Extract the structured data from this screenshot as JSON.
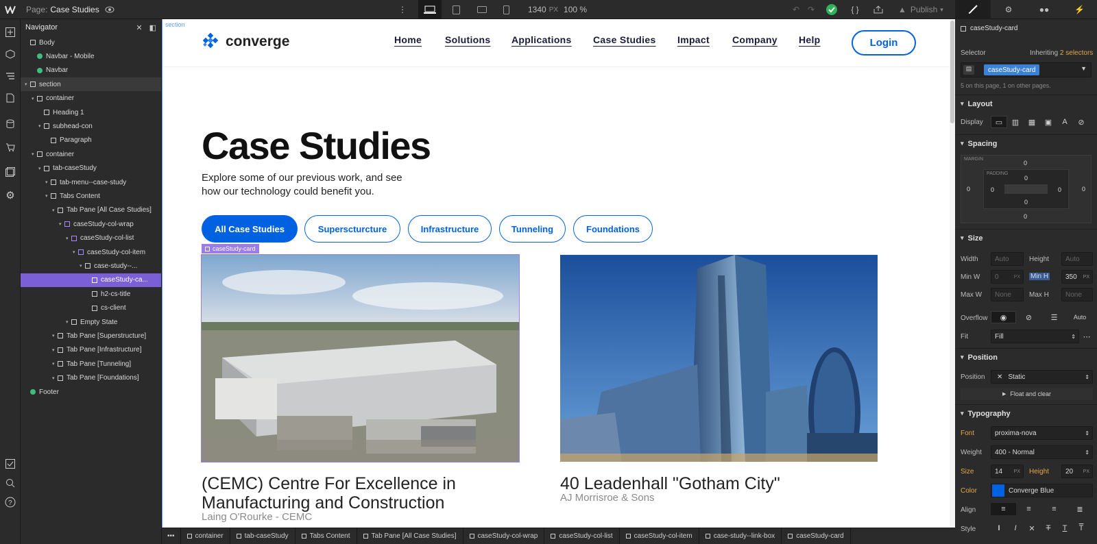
{
  "topbar": {
    "page_label": "Page:",
    "page_name": "Case Studies",
    "viewport_width": "1340",
    "viewport_unit": "PX",
    "zoom": "100 %",
    "publish_label": "Publish"
  },
  "navigator": {
    "title": "Navigator",
    "items": [
      {
        "label": "Body"
      },
      {
        "label": "Navbar - Mobile"
      },
      {
        "label": "Navbar"
      },
      {
        "label": "section"
      },
      {
        "label": "container"
      },
      {
        "label": "Heading 1"
      },
      {
        "label": "subhead-con"
      },
      {
        "label": "Paragraph"
      },
      {
        "label": "container"
      },
      {
        "label": "tab-caseStudy"
      },
      {
        "label": "tab-menu--case-study"
      },
      {
        "label": "Tabs Content"
      },
      {
        "label": "Tab Pane [All Case Studies]"
      },
      {
        "label": "caseStudy-col-wrap"
      },
      {
        "label": "caseStudy-col-list"
      },
      {
        "label": "caseStudy-col-item"
      },
      {
        "label": "case-study--..."
      },
      {
        "label": "caseStudy-ca..."
      },
      {
        "label": "h2-cs-title"
      },
      {
        "label": "cs-client"
      },
      {
        "label": "Empty State"
      },
      {
        "label": "Tab Pane [Superstructure]"
      },
      {
        "label": "Tab Pane [Infrastructure]"
      },
      {
        "label": "Tab Pane [Tunneling]"
      },
      {
        "label": "Tab Pane [Foundations]"
      },
      {
        "label": "Footer"
      }
    ]
  },
  "canvas": {
    "section_tag": "section",
    "logo_text": "converge",
    "menu": [
      "Home",
      "Solutions",
      "Applications",
      "Case Studies",
      "Impact",
      "Company",
      "Help"
    ],
    "login_label": "Login",
    "heading": "Case Studies",
    "subheading": "Explore some of our previous work, and see how our technology could benefit you.",
    "filters": [
      "All Case Studies",
      "Superscturcture",
      "Infrastructure",
      "Tunneling",
      "Foundations"
    ],
    "card_tag": "caseStudy-card",
    "cards": [
      {
        "title": "(CEMC) Centre For Excellence in Manufacturing and Construction",
        "client": "Laing O'Rourke - CEMC"
      },
      {
        "title": "40 Leadenhall \"Gotham City\"",
        "client": "AJ Morrisroe & Sons"
      }
    ]
  },
  "panel": {
    "element_name": "caseStudy-card",
    "selector_label": "Selector",
    "inheriting": "Inheriting",
    "inheriting_count": "2 selectors",
    "selector_chip": "caseStudy-card",
    "usage_note": "5 on this page, 1 on other pages.",
    "layout_title": "Layout",
    "display_label": "Display",
    "spacing_title": "Spacing",
    "margin_label": "MARGIN",
    "padding_label": "PADDING",
    "margin_top": "0",
    "margin_right": "0",
    "margin_bottom": "0",
    "margin_left": "0",
    "padding_top": "0",
    "padding_right": "0",
    "padding_bottom": "0",
    "padding_left": "0",
    "size_title": "Size",
    "width_label": "Width",
    "width_value": "Auto",
    "height_label": "Height",
    "height_value": "Auto",
    "minw_label": "Min W",
    "minw_value": "0",
    "minw_unit": "PX",
    "minh_label": "Min H",
    "minh_value": "350",
    "minh_unit": "PX",
    "maxw_label": "Max W",
    "maxw_value": "None",
    "maxh_label": "Max H",
    "maxh_value": "None",
    "overflow_label": "Overflow",
    "overflow_auto": "Auto",
    "fit_label": "Fit",
    "fit_value": "Fill",
    "position_title": "Position",
    "position_label": "Position",
    "position_value": "Static",
    "float_label": "Float and clear",
    "typography_title": "Typography",
    "font_label": "Font",
    "font_value": "proxima-nova",
    "weight_label": "Weight",
    "weight_value": "400 - Normal",
    "size_label": "Size",
    "size_value": "14",
    "size_unit": "PX",
    "lh_label": "Height",
    "lh_value": "20",
    "lh_unit": "PX",
    "color_label": "Color",
    "color_value": "Converge Blue",
    "color_hex": "#0062e1",
    "align_label": "Align",
    "style_label": "Style"
  },
  "breadcrumbs": [
    "container",
    "tab-caseStudy",
    "Tabs Content",
    "Tab Pane [All Case Studies]",
    "caseStudy-col-wrap",
    "caseStudy-col-list",
    "caseStudy-col-item",
    "case-study--link-box",
    "caseStudy-card"
  ],
  "colors": {
    "accent": "#0062e1",
    "selection": "#7b5fd6",
    "publish_ok": "#2fb35a"
  }
}
